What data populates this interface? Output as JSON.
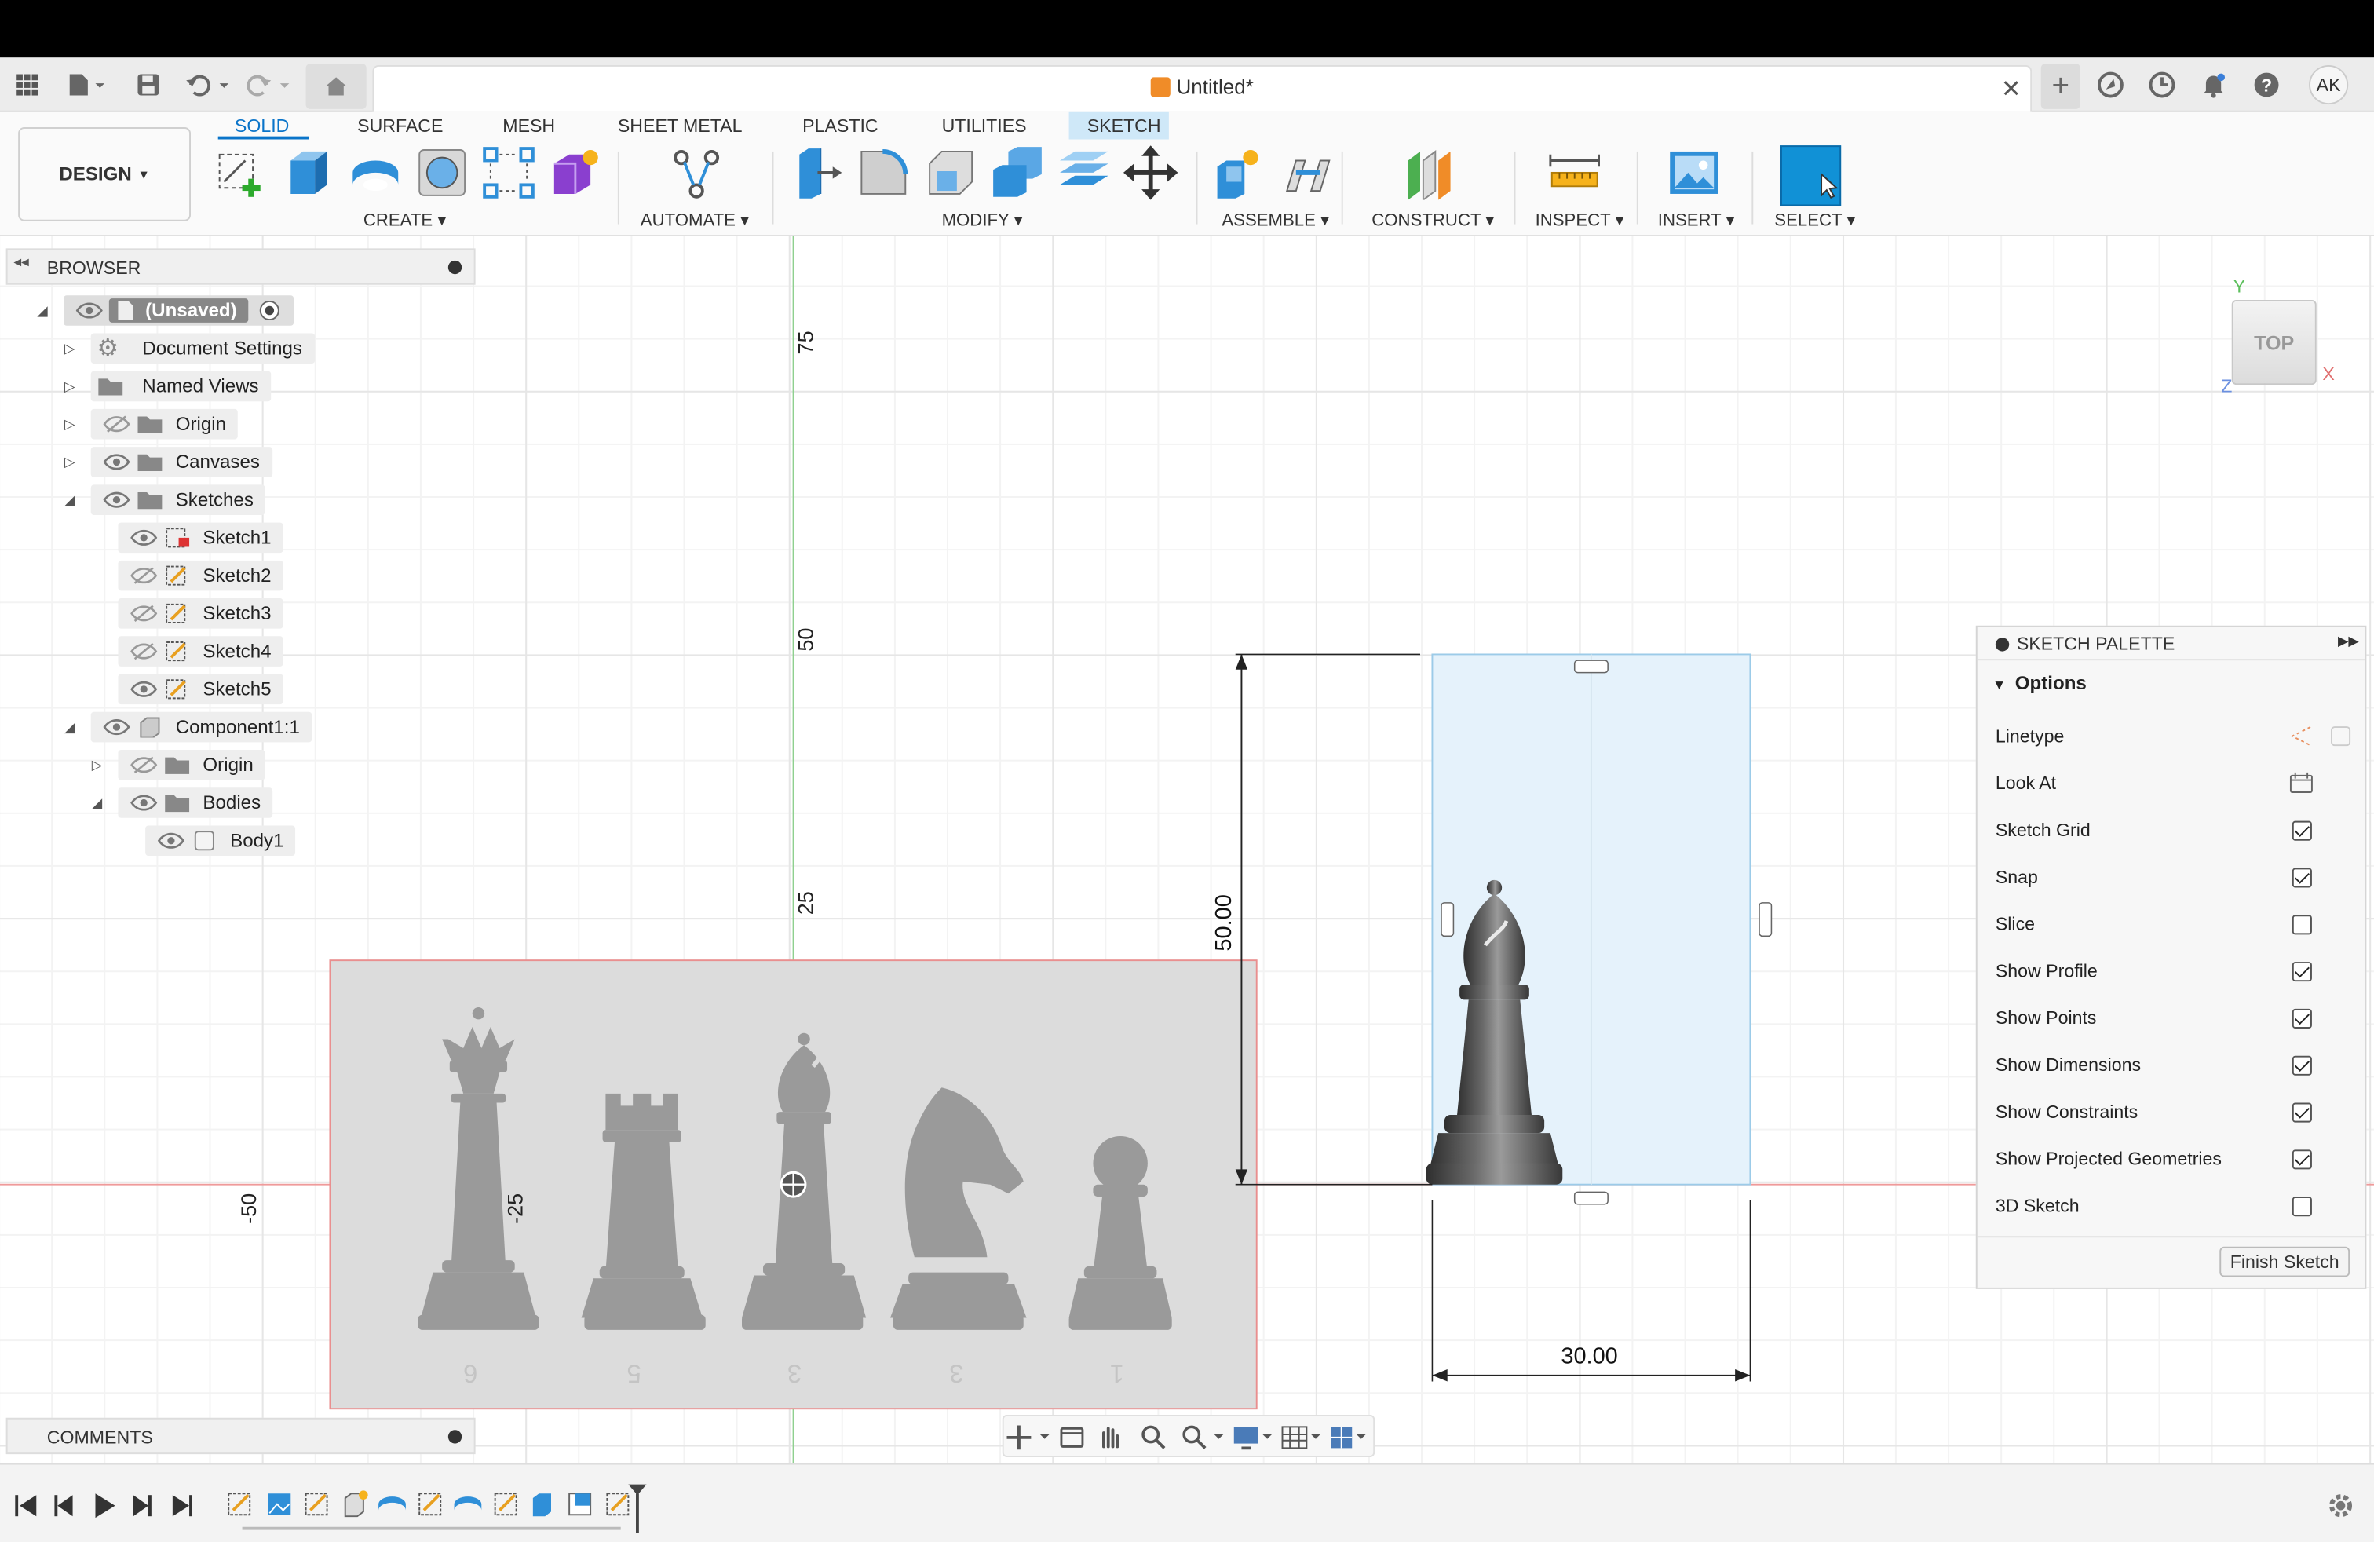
{
  "app": {
    "doc_title": "Untitled*",
    "avatar": "AK"
  },
  "ribbon": {
    "tabs": [
      "SOLID",
      "SURFACE",
      "MESH",
      "SHEET METAL",
      "PLASTIC",
      "UTILITIES",
      "SKETCH"
    ],
    "active_tab": "SOLID",
    "workspace": "DESIGN",
    "groups": [
      "CREATE",
      "AUTOMATE",
      "MODIFY",
      "ASSEMBLE",
      "CONSTRUCT",
      "INSPECT",
      "INSERT",
      "SELECT"
    ]
  },
  "browser": {
    "title": "BROWSER",
    "root": "(Unsaved)",
    "items": [
      "Document Settings",
      "Named Views",
      "Origin",
      "Canvases",
      "Sketches",
      "Sketch1",
      "Sketch2",
      "Sketch3",
      "Sketch4",
      "Sketch5",
      "Component1:1",
      "Origin",
      "Bodies",
      "Body1"
    ]
  },
  "canvas": {
    "axis_labels": [
      "75",
      "50",
      "25",
      "-50",
      "-25"
    ],
    "dim_height": "50.00",
    "dim_width": "30.00",
    "piece_numbers": [
      "6",
      "5",
      "3",
      "3",
      "1"
    ],
    "viewcube": {
      "face": "TOP",
      "x": "X",
      "y": "Y",
      "z": "Z"
    }
  },
  "palette": {
    "title": "SKETCH PALETTE",
    "section": "Options",
    "rows": [
      {
        "label": "Linetype",
        "kind": "icons"
      },
      {
        "label": "Look At",
        "kind": "icon"
      },
      {
        "label": "Sketch Grid",
        "checked": true
      },
      {
        "label": "Snap",
        "checked": true
      },
      {
        "label": "Slice",
        "checked": false
      },
      {
        "label": "Show Profile",
        "checked": true
      },
      {
        "label": "Show Points",
        "checked": true
      },
      {
        "label": "Show Dimensions",
        "checked": true
      },
      {
        "label": "Show Constraints",
        "checked": true
      },
      {
        "label": "Show Projected Geometries",
        "checked": true
      },
      {
        "label": "3D Sketch",
        "checked": false
      }
    ],
    "finish": "Finish Sketch"
  },
  "comments": {
    "title": "COMMENTS"
  },
  "colors": {
    "accent": "#0a74c9",
    "x_axis": "#e07070",
    "y_axis": "#78c878",
    "sketch_region": "#e5f2fb"
  }
}
